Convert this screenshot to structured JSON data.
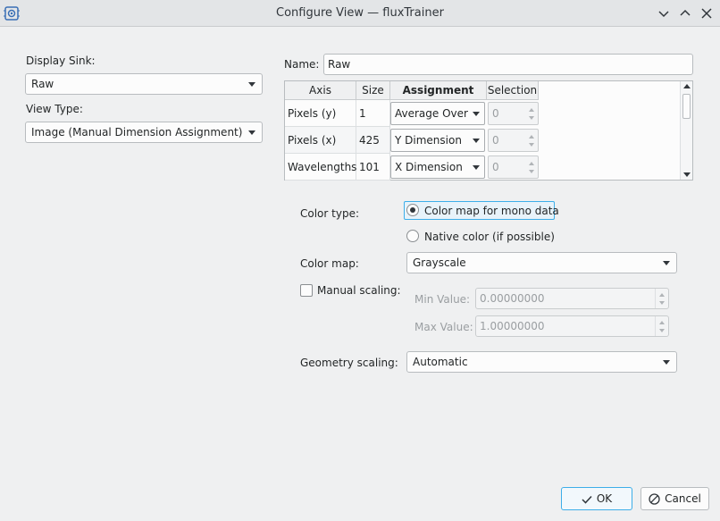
{
  "window": {
    "title": "Configure View — fluxTrainer",
    "app_icon": "chip-gear-icon"
  },
  "left": {
    "display_sink_label": "Display Sink:",
    "display_sink_value": "Raw",
    "view_type_label": "View Type:",
    "view_type_value": "Image (Manual Dimension Assignment)"
  },
  "name": {
    "label": "Name:",
    "value": "Raw"
  },
  "table": {
    "headers": [
      "Axis",
      "Size",
      "Assignment",
      "Selection"
    ],
    "rows": [
      {
        "axis": "Pixels (y)",
        "size": "1",
        "assignment": "Average Over",
        "selection": "0"
      },
      {
        "axis": "Pixels (x)",
        "size": "425",
        "assignment": "Y Dimension",
        "selection": "0"
      },
      {
        "axis": "Wavelengths",
        "size": "101",
        "assignment": "X Dimension",
        "selection": "0"
      }
    ]
  },
  "color": {
    "type_label": "Color type:",
    "option_mono": "Color map for mono data",
    "option_native": "Native color (if possible)",
    "map_label": "Color map:",
    "map_value": "Grayscale"
  },
  "scaling": {
    "manual_label": "Manual scaling:",
    "min_label": "Min Value:",
    "min_value": "0.00000000",
    "max_label": "Max Value:",
    "max_value": "1.00000000",
    "geometry_label": "Geometry scaling:",
    "geometry_value": "Automatic"
  },
  "buttons": {
    "ok": "OK",
    "cancel": "Cancel"
  },
  "colors": {
    "accent": "#3daee9",
    "window_bg": "#eff0f1"
  }
}
